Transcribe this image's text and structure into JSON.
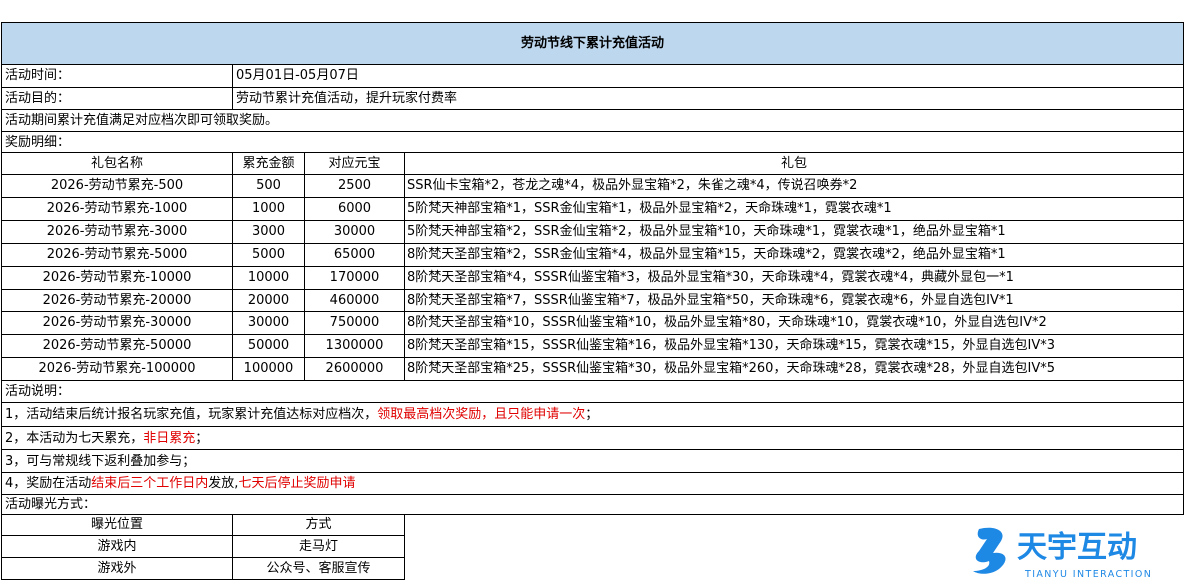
{
  "title": "劳动节线下累计充值活动",
  "info": {
    "time_label": "活动时间：",
    "time_value": "05月01日-05月07日",
    "purpose_label": "活动目的：",
    "purpose_value": "劳动节累计充值活动，提升玩家付费率",
    "condition": "活动期间累计充值满足对应档次即可领取奖励。",
    "reward_label": "奖励明细："
  },
  "rewards": {
    "headers": [
      "礼包名称",
      "累充金额",
      "对应元宝",
      "礼包"
    ],
    "rows": [
      [
        "2026-劳动节累充-500",
        "500",
        "2500",
        "SSR仙卡宝箱*2，苍龙之魂*4，极品外显宝箱*2，朱雀之魂*4，传说召唤券*2"
      ],
      [
        "2026-劳动节累充-1000",
        "1000",
        "6000",
        "5阶梵天神部宝箱*1，SSR金仙宝箱*1，极品外显宝箱*2，天命珠魂*1，霓裳衣魂*1"
      ],
      [
        "2026-劳动节累充-3000",
        "3000",
        "30000",
        "5阶梵天神部宝箱*2，SSR金仙宝箱*2，极品外显宝箱*10，天命珠魂*1，霓裳衣魂*1，绝品外显宝箱*1"
      ],
      [
        "2026-劳动节累充-5000",
        "5000",
        "65000",
        "8阶梵天圣部宝箱*2，SSR金仙宝箱*4，极品外显宝箱*15，天命珠魂*2，霓裳衣魂*2，绝品外显宝箱*1"
      ],
      [
        "2026-劳动节累充-10000",
        "10000",
        "170000",
        "8阶梵天圣部宝箱*4，SSSR仙鉴宝箱*3，极品外显宝箱*30，天命珠魂*4，霓裳衣魂*4，典藏外显包一*1"
      ],
      [
        "2026-劳动节累充-20000",
        "20000",
        "460000",
        "8阶梵天圣部宝箱*7，SSSR仙鉴宝箱*7，极品外显宝箱*50，天命珠魂*6，霓裳衣魂*6，外显自选包IV*1"
      ],
      [
        "2026-劳动节累充-30000",
        "30000",
        "750000",
        "8阶梵天圣部宝箱*10，SSSR仙鉴宝箱*10，极品外显宝箱*80，天命珠魂*10，霓裳衣魂*10，外显自选包IV*2"
      ],
      [
        "2026-劳动节累充-50000",
        "50000",
        "1300000",
        "8阶梵天圣部宝箱*15，SSSR仙鉴宝箱*16，极品外显宝箱*130，天命珠魂*15，霓裳衣魂*15，外显自选包IV*3"
      ],
      [
        "2026-劳动节累充-100000",
        "100000",
        "2600000",
        "8阶梵天圣部宝箱*25，SSSR仙鉴宝箱*30，极品外显宝箱*260，天命珠魂*28，霓裳衣魂*28，外显自选包IV*5"
      ]
    ]
  },
  "notes": {
    "label": "活动说明：",
    "n1_a": "1，活动结束后统计报名玩家充值，玩家累计充值达标对应档次，",
    "n1_red": "领取最高档次奖励，且只能申请一次",
    "n1_b": "；",
    "n2_a": "2，本活动为七天累充，",
    "n2_red": "非日累充",
    "n2_b": "；",
    "n3": "3，可与常规线下返利叠加参与；",
    "n4_a": "4，奖励在活动",
    "n4_red1": "结束后三个工作日内",
    "n4_b": "发放,",
    "n4_red2": "七天后停止奖励申请"
  },
  "exposure": {
    "label": "活动曝光方式：",
    "headers": [
      "曝光位置",
      "方式"
    ],
    "rows": [
      [
        "游戏内",
        "走马灯"
      ],
      [
        "游戏外",
        "公众号、客服宣传"
      ]
    ]
  },
  "logo": {
    "name": "天宇互动",
    "sub": "TIANYU INTERACTION",
    "color": "#1e88e5"
  }
}
